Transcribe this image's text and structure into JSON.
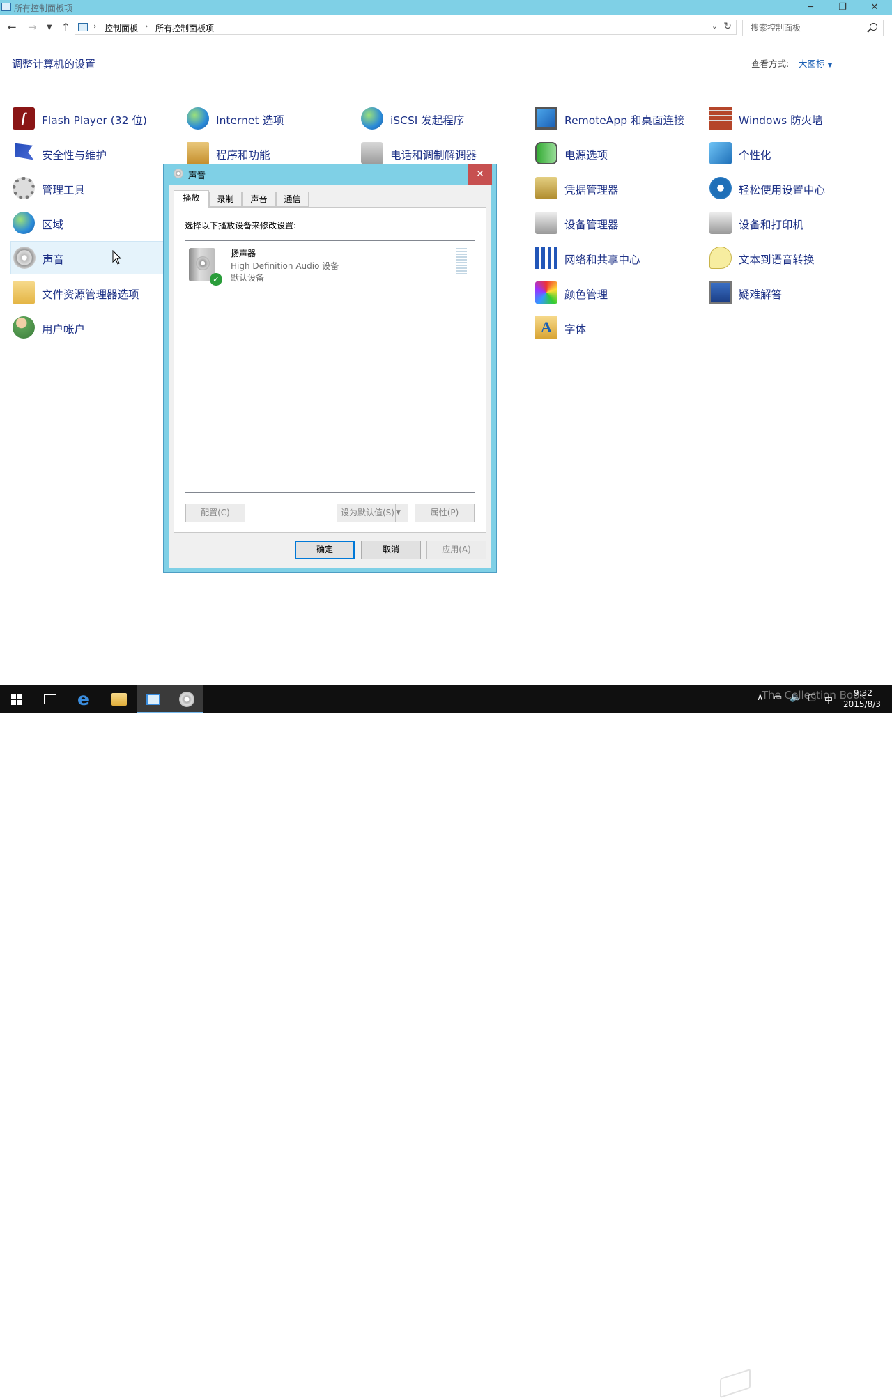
{
  "window": {
    "title": "所有控制面板项",
    "minimize_icon": "minimize-icon",
    "restore_icon": "restore-icon",
    "close_icon": "close-icon"
  },
  "address_bar": {
    "breadcrumbs": [
      "控制面板",
      "所有控制面板项"
    ],
    "search_placeholder": "搜索控制面板"
  },
  "header": {
    "title": "调整计算机的设置",
    "view_by_label": "查看方式:",
    "view_by_value": "大图标"
  },
  "items": [
    {
      "label": "Flash Player (32 位)",
      "icon": "flash-icon"
    },
    {
      "label": "安全性与维护",
      "icon": "flag-icon"
    },
    {
      "label": "管理工具",
      "icon": "admin-tools-icon"
    },
    {
      "label": "区域",
      "icon": "globe-clock-icon"
    },
    {
      "label": "声音",
      "icon": "speaker-icon"
    },
    {
      "label": "文件资源管理器选项",
      "icon": "folder-options-icon"
    },
    {
      "label": "用户帐户",
      "icon": "users-icon"
    },
    {
      "label": "Internet 选项",
      "icon": "internet-options-icon"
    },
    {
      "label": "程序和功能",
      "icon": "programs-icon"
    },
    {
      "label": "iSCSI 发起程序",
      "icon": "iscsi-icon"
    },
    {
      "label": "电话和调制解调器",
      "icon": "phone-modem-icon"
    },
    {
      "label": "RemoteApp 和桌面连接",
      "icon": "remoteapp-icon"
    },
    {
      "label": "电源选项",
      "icon": "power-icon"
    },
    {
      "label": "凭据管理器",
      "icon": "credential-icon"
    },
    {
      "label": "设备管理器",
      "icon": "device-manager-icon"
    },
    {
      "label": "网络和共享中心",
      "icon": "network-icon"
    },
    {
      "label": "颜色管理",
      "icon": "color-management-icon"
    },
    {
      "label": "字体",
      "icon": "fonts-icon"
    },
    {
      "label": "Windows 防火墙",
      "icon": "firewall-icon"
    },
    {
      "label": "个性化",
      "icon": "personalization-icon"
    },
    {
      "label": "轻松使用设置中心",
      "icon": "ease-of-access-icon"
    },
    {
      "label": "设备和打印机",
      "icon": "printer-icon"
    },
    {
      "label": "文本到语音转换",
      "icon": "speech-icon"
    },
    {
      "label": "疑难解答",
      "icon": "troubleshooting-icon"
    }
  ],
  "dialog": {
    "title": "声音",
    "close_label": "✕",
    "tabs": [
      "播放",
      "录制",
      "声音",
      "通信"
    ],
    "active_tab": "播放",
    "instruction": "选择以下播放设备来修改设置:",
    "device": {
      "name": "扬声器",
      "description": "High Definition Audio 设备",
      "status": "默认设备"
    },
    "buttons": {
      "configure": "配置(C)",
      "set_default": "设为默认值(S)",
      "properties": "属性(P)",
      "ok": "确定",
      "cancel": "取消",
      "apply": "应用(A)"
    }
  },
  "taskbar": {
    "clock_time": "9:32",
    "clock_date": "2015/8/3",
    "ime": "中",
    "watermark": "The Collection Book"
  },
  "colors": {
    "titlebar": "#7fd0e6",
    "link": "#1e3287",
    "close_button": "#c75050",
    "taskbar": "#101010"
  }
}
